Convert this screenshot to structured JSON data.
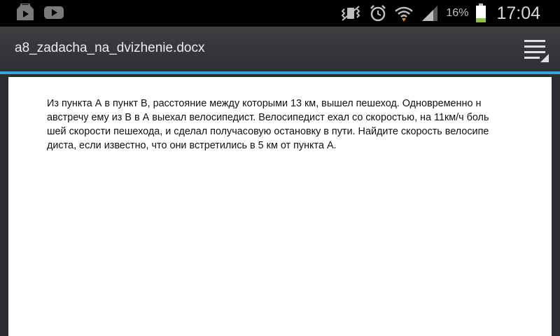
{
  "status_bar": {
    "icons_left": [
      "play-store-icon",
      "youtube-icon"
    ],
    "icons_right": [
      "vibrate-icon",
      "alarm-icon",
      "wifi-icon",
      "signal-icon",
      "battery-icon"
    ],
    "battery_percent": "16%",
    "time": "17:04"
  },
  "action_bar": {
    "title": "a8_zadacha_na_dvizhenie.docx",
    "accent_color": "#35a2de",
    "menu_icon": "menu-icon"
  },
  "document": {
    "lines": [
      "Из пункта А в пункт В, расстояние между которыми 13 км, вышел пешеход. Одновременно н",
      "австречу ему из В в А выехал велосипедист. Велосипедист ехал со скоростью, на 11км/ч боль",
      "шей скорости пешехода, и сделал получасовую остановку в пути. Найдите скорость велосипе",
      "диста, если известно, что они встретились в 5 км от пункта А."
    ]
  }
}
